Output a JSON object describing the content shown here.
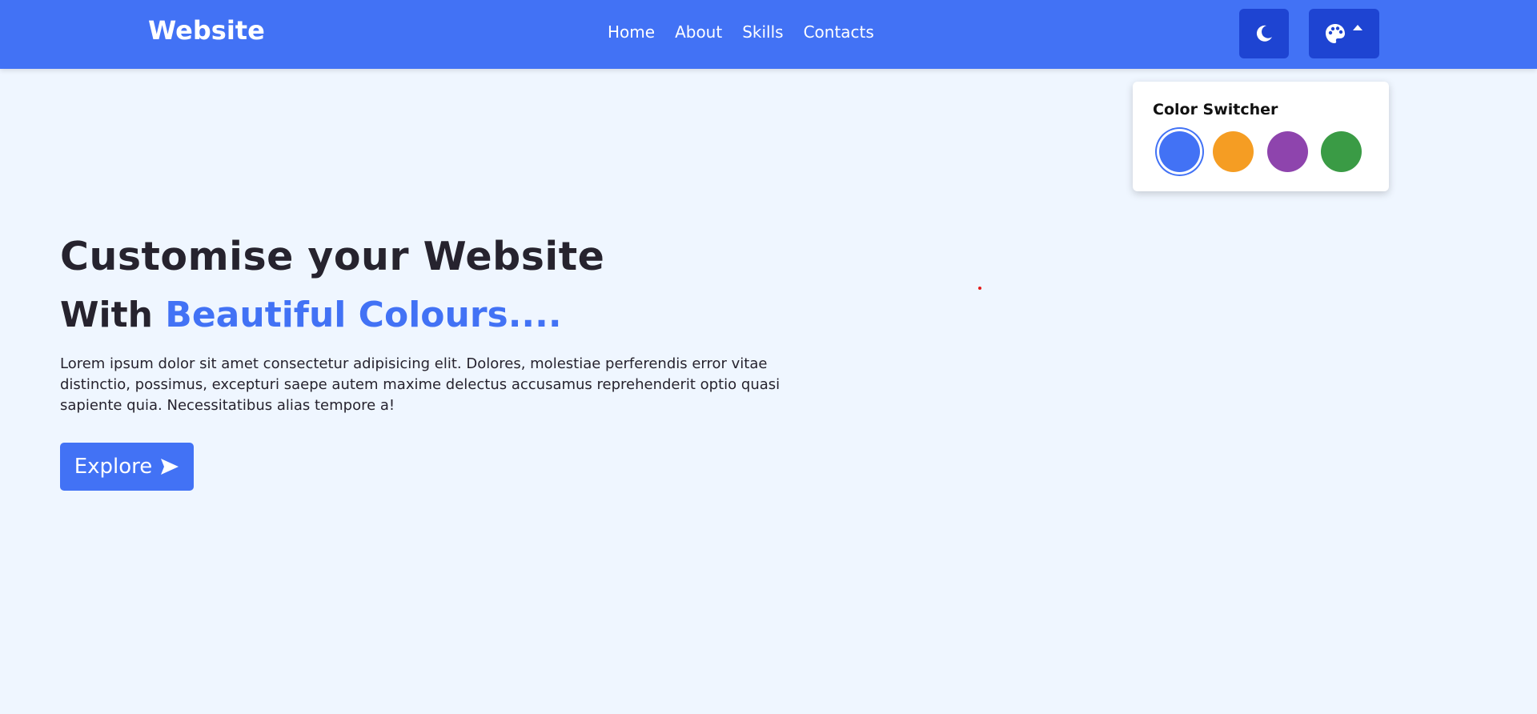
{
  "navbar": {
    "brand": "Website",
    "links": [
      "Home",
      "About",
      "Skills",
      "Contacts"
    ],
    "background_color": "#4272f5",
    "button_color": "#1e44d2",
    "theme_icon": "moon-icon",
    "palette_icon": "palette-icon",
    "caret_icon": "caret-up-icon"
  },
  "color_switcher": {
    "title": "Color Switcher",
    "swatches": [
      {
        "name": "blue",
        "color": "#4272f5",
        "selected": true
      },
      {
        "name": "orange",
        "color": "#f59d23"
      },
      {
        "name": "purple",
        "color": "#8e44ad"
      },
      {
        "name": "green",
        "color": "#3a9b45"
      }
    ]
  },
  "hero": {
    "title": "Customise your Website",
    "subtitle_prefix": "With ",
    "subtitle_accent": "Beautiful Colours....",
    "paragraph": "Lorem ipsum dolor sit amet consectetur adipisicing elit. Dolores, molestiae perferendis error vitae distinctio, possimus, excepturi saepe autem maxime delectus accusamus reprehenderit optio quasi sapiente quia. Necessitatibus alias tempore a!",
    "button_label": "Explore",
    "button_icon": "send-arrow-icon"
  },
  "colors": {
    "page_background": "#eff6ff",
    "text_dark": "#26232e",
    "accent": "#4272f5"
  }
}
